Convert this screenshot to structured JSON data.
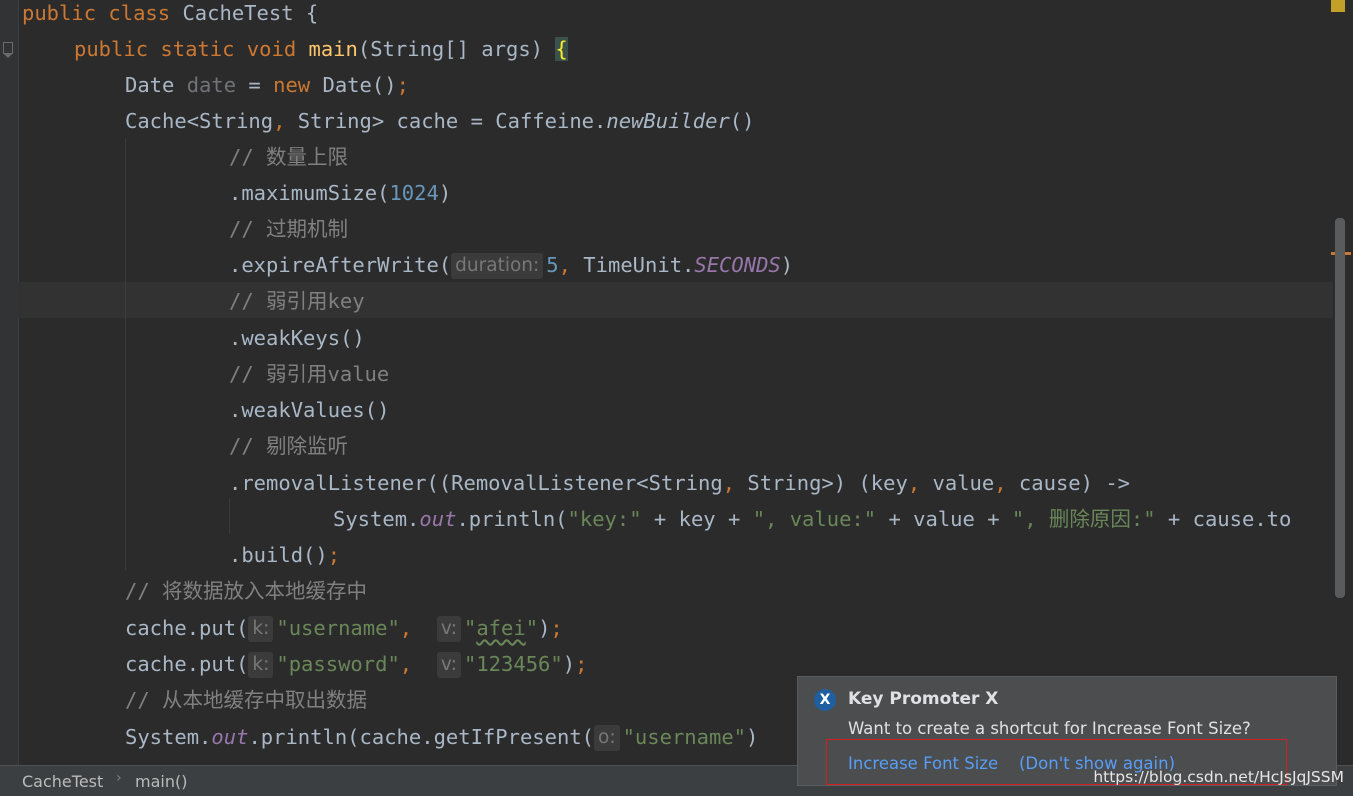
{
  "code": {
    "class_decl": {
      "kw": "public class ",
      "name": "CacheTest {"
    },
    "main_decl": {
      "kw": "public static void ",
      "name": "main",
      "params": "(String[] args) ",
      "brace": "{"
    },
    "line_date": {
      "type": "Date ",
      "var": "date",
      "eq": " = ",
      "new": "new",
      "rest": " Date()",
      "semi": ";"
    },
    "line_cache": {
      "a": "Cache<String",
      "comma": ",",
      "b": " String> cache = Caffeine.",
      "method": "newBuilder",
      "c": "()"
    },
    "comment_max": "// 数量上限",
    "line_max": {
      "a": ".maximumSize(",
      "num": "1024",
      "b": ")"
    },
    "comment_expire": "// 过期机制",
    "line_expire": {
      "a": ".expireAfterWrite(",
      "hint": "duration:",
      "num": "5",
      "comma": ",",
      "b": " TimeUnit.",
      "field": "SECONDS",
      "c": ")"
    },
    "comment_weakkey": "// 弱引用key",
    "line_weakkeys": ".weakKeys()",
    "comment_weakval": "// 弱引用value",
    "line_weakvalues": ".weakValues()",
    "comment_remove": "// 剔除监听",
    "line_removal": {
      "a": ".removalListener((RemovalListener<String",
      "c1": ",",
      "b": " String>) (key",
      "c2": ",",
      "c": " value",
      "c3": ",",
      "d": " cause) ->"
    },
    "line_println1": {
      "a": "System.",
      "out": "out",
      "b": ".println(",
      "s1": "\"key:\"",
      "c": " + key + ",
      "s2": "\", value:\"",
      "d": " + value + ",
      "s3": "\", 删除原因:\"",
      "e": " + cause.to"
    },
    "line_build": {
      "a": ".build()",
      "semi": ";"
    },
    "comment_put": "// 将数据放入本地缓存中",
    "line_put1": {
      "a": "cache.put(",
      "hk": "k:",
      "s1": "\"username\"",
      "comma": ",",
      "hv": "v:",
      "s2q1": "\"",
      "s2": "afei",
      "s2q2": "\"",
      "b": ")",
      "semi": ";"
    },
    "line_put2": {
      "a": "cache.put(",
      "hk": "k:",
      "s1": "\"password\"",
      "comma": ",",
      "hv": "v:",
      "s2": "\"123456\"",
      "b": ")",
      "semi": ";"
    },
    "comment_get": "// 从本地缓存中取出数据",
    "line_println2": {
      "a": "System.",
      "out": "out",
      "b": ".println(cache.getIfPresent(",
      "hint": "o:",
      "s": "\"username\"",
      "c": ")"
    }
  },
  "statusbar": {
    "crumb1": "CacheTest",
    "sep": "›",
    "crumb2": "main()"
  },
  "notification": {
    "title": "Key Promoter X",
    "body": "Want to create a shortcut for Increase Font Size?",
    "action1": "Increase Font Size",
    "action2": "(Don't show again)"
  },
  "watermark": "https://blog.csdn.net/HcJsJqJSSM",
  "colors": {
    "keyword": "#cc7832",
    "string": "#6a8759",
    "number": "#6897bb",
    "comment": "#808080",
    "field": "#9876aa",
    "method": "#ffc66d",
    "link": "#589df6",
    "highlight_box": "#d22020"
  },
  "icons": {
    "fold": "fold-marker-icon",
    "kpx": "key-promoter-x-icon"
  }
}
